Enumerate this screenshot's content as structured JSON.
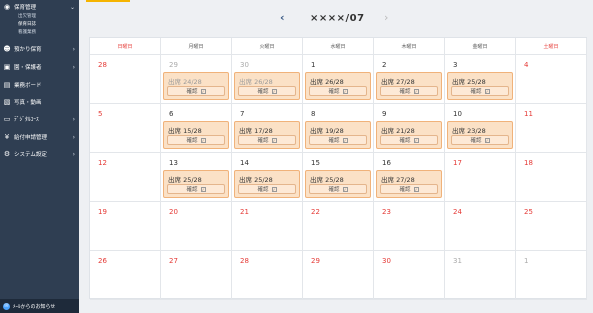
{
  "sidebar": {
    "main_menu": {
      "label": "保育管理"
    },
    "sub_items": [
      "出欠管理",
      "保育日誌",
      "看護業務"
    ],
    "items": [
      {
        "label": "預かり保育",
        "icon": "person-icon"
      },
      {
        "label": "園・保護者",
        "icon": "person-card-icon"
      },
      {
        "label": "業務ボード",
        "icon": "board-icon"
      },
      {
        "label": "写真・動画",
        "icon": "photo-icon"
      },
      {
        "label": "ﾃﾞｼﾞﾀﾙｺｰｽ",
        "icon": "screen-icon"
      },
      {
        "label": "給付申請管理",
        "icon": "yen-icon"
      },
      {
        "label": "システム設定",
        "icon": "gear-icon"
      }
    ],
    "footer": {
      "label": "ﾒｰﾙからのお知らせ"
    }
  },
  "month_nav": {
    "prev": "‹",
    "title": "××××/07",
    "next": "›"
  },
  "weekdays": [
    "日曜日",
    "月曜日",
    "火曜日",
    "水曜日",
    "木曜日",
    "金曜日",
    "土曜日"
  ],
  "confirm_label": "確認",
  "weeks": [
    [
      {
        "day": "28",
        "style": "red"
      },
      {
        "day": "29",
        "style": "gray",
        "att": "出席 24/28",
        "dim": true
      },
      {
        "day": "30",
        "style": "gray",
        "att": "出席 26/28",
        "dim": true
      },
      {
        "day": "1",
        "style": "normal",
        "att": "出席 26/28"
      },
      {
        "day": "2",
        "style": "normal",
        "att": "出席 27/28"
      },
      {
        "day": "3",
        "style": "normal",
        "att": "出席 25/28"
      },
      {
        "day": "4",
        "style": "red"
      }
    ],
    [
      {
        "day": "5",
        "style": "red"
      },
      {
        "day": "6",
        "style": "normal",
        "att": "出席 15/28"
      },
      {
        "day": "7",
        "style": "normal",
        "att": "出席 17/28"
      },
      {
        "day": "8",
        "style": "normal",
        "att": "出席 19/28"
      },
      {
        "day": "9",
        "style": "normal",
        "att": "出席 21/28"
      },
      {
        "day": "10",
        "style": "normal",
        "att": "出席 23/28"
      },
      {
        "day": "11",
        "style": "red"
      }
    ],
    [
      {
        "day": "12",
        "style": "red"
      },
      {
        "day": "13",
        "style": "normal",
        "att": "出席 25/28"
      },
      {
        "day": "14",
        "style": "normal",
        "att": "出席 25/28"
      },
      {
        "day": "15",
        "style": "normal",
        "att": "出席 25/28"
      },
      {
        "day": "16",
        "style": "normal",
        "att": "出席 27/28"
      },
      {
        "day": "17",
        "style": "red"
      },
      {
        "day": "18",
        "style": "red"
      }
    ],
    [
      {
        "day": "19",
        "style": "red"
      },
      {
        "day": "20",
        "style": "red"
      },
      {
        "day": "21",
        "style": "red"
      },
      {
        "day": "22",
        "style": "red"
      },
      {
        "day": "23",
        "style": "red"
      },
      {
        "day": "24",
        "style": "red"
      },
      {
        "day": "25",
        "style": "red"
      }
    ],
    [
      {
        "day": "26",
        "style": "red"
      },
      {
        "day": "27",
        "style": "red"
      },
      {
        "day": "28",
        "style": "red"
      },
      {
        "day": "29",
        "style": "red"
      },
      {
        "day": "30",
        "style": "red"
      },
      {
        "day": "31",
        "style": "gray"
      },
      {
        "day": "1",
        "style": "gray"
      }
    ]
  ],
  "colors": {
    "sidebar_bg": "#2f3e52",
    "accent_yellow": "#f5b400",
    "holiday_red": "#e53935",
    "attendance_fill": "#fbe1c6",
    "attendance_border": "#f0b27a"
  }
}
